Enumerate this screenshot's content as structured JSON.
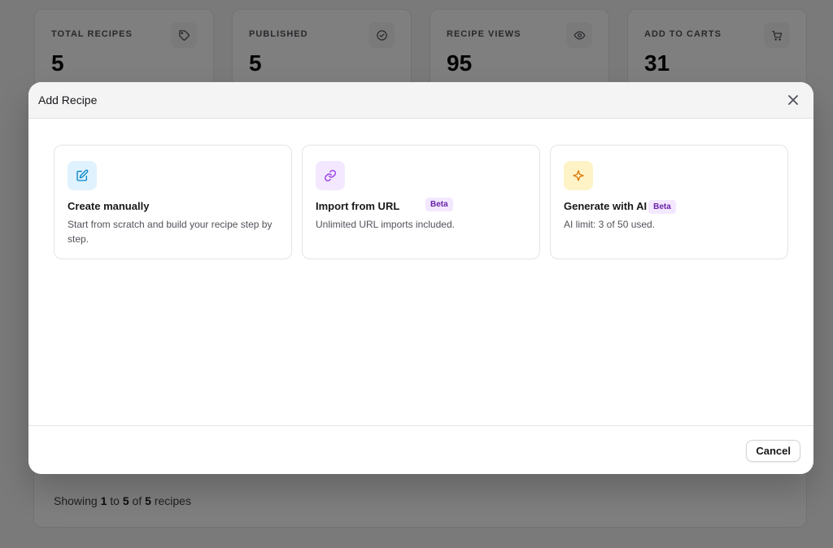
{
  "stats": [
    {
      "label": "TOTAL RECIPES",
      "value": "5",
      "icon": "tag-icon"
    },
    {
      "label": "PUBLISHED",
      "value": "5",
      "icon": "check-circle-icon"
    },
    {
      "label": "RECIPE VIEWS",
      "value": "95",
      "icon": "eye-icon"
    },
    {
      "label": "ADD TO CARTS",
      "value": "31",
      "icon": "cart-icon"
    }
  ],
  "pagination": {
    "prefix": "Showing",
    "from": "1",
    "to_word": "to",
    "to": "5",
    "of_word": "of",
    "total": "5",
    "suffix": "recipes"
  },
  "modal": {
    "title": "Add Recipe",
    "options": [
      {
        "title": "Create manually",
        "description": "Start from scratch and build your recipe step by step.",
        "icon": "edit-icon",
        "icon_bg": "#e0f2fe",
        "icon_color": "#0284c7"
      },
      {
        "title": "Import from URL",
        "badge": "Beta",
        "description": "Unlimited URL imports included.",
        "icon": "link-icon",
        "icon_bg": "#f3e8ff",
        "icon_color": "#9333ea"
      },
      {
        "title": "Generate with AI",
        "badge": "Beta",
        "description": "AI limit: 3 of 50 used.",
        "icon": "sparkle-icon",
        "icon_bg": "#fef3c7",
        "icon_color": "#d97706"
      }
    ],
    "cancel_label": "Cancel"
  },
  "colors": {
    "overlay": "rgba(0,0,0,0.5)",
    "badge_bg": "#f3e8ff",
    "badge_text": "#6b21a8"
  }
}
